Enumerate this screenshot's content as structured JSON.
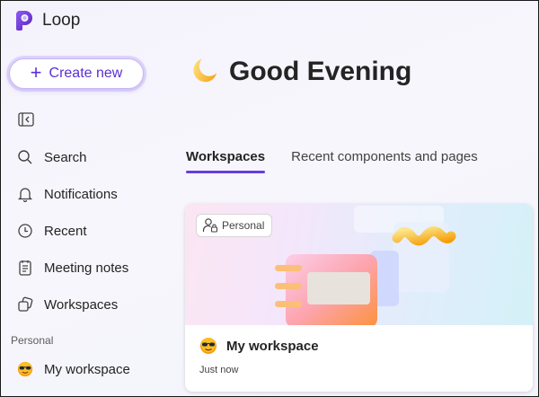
{
  "app": {
    "name": "Loop"
  },
  "sidebar": {
    "create_label": "Create new",
    "items": [
      {
        "label": "Search",
        "icon": "search-icon"
      },
      {
        "label": "Notifications",
        "icon": "bell-icon"
      },
      {
        "label": "Recent",
        "icon": "clock-icon"
      },
      {
        "label": "Meeting notes",
        "icon": "notes-icon"
      },
      {
        "label": "Workspaces",
        "icon": "workspaces-icon"
      }
    ],
    "section_label": "Personal",
    "workspace_item": "My workspace"
  },
  "main": {
    "greeting": "Good Evening",
    "tabs": [
      {
        "label": "Workspaces",
        "active": true
      },
      {
        "label": "Recent components and pages",
        "active": false
      }
    ],
    "card": {
      "badge": "Personal",
      "title": "My workspace",
      "time": "Just now"
    }
  },
  "colors": {
    "accent": "#6a3be5",
    "create_text": "#5b2fd6"
  }
}
